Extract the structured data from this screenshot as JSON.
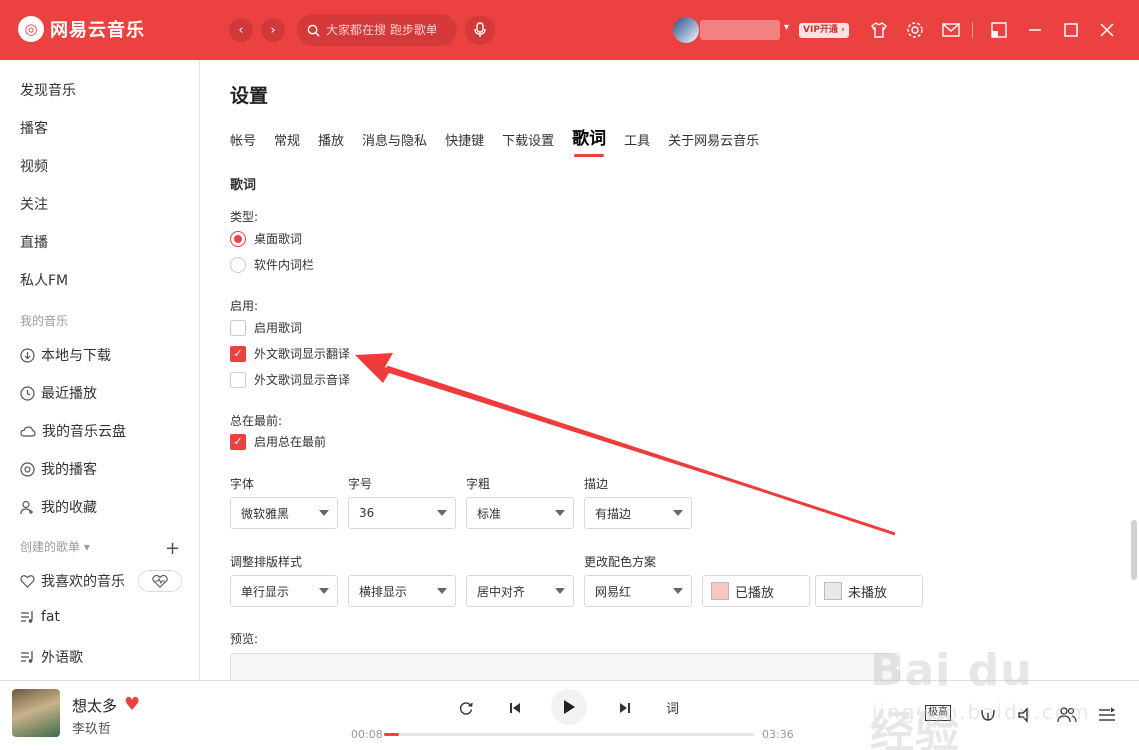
{
  "app": {
    "name": "网易云音乐",
    "logo_glyph": "◎",
    "accent": "#ec4141"
  },
  "header": {
    "back_glyph": "‹",
    "forward_glyph": "›",
    "search_placeholder": "大家都在搜 跑步歌单",
    "vip_badge": "VIP开通 ›",
    "icons": [
      "mic-icon",
      "skin-icon",
      "settings-icon",
      "mail-icon",
      "mini-mode-icon",
      "minimize-icon",
      "maximize-icon",
      "close-icon"
    ]
  },
  "sidebar": {
    "nav": [
      "发现音乐",
      "播客",
      "视频",
      "关注",
      "直播",
      "私人FM"
    ],
    "my_music_title": "我的音乐",
    "my_music": [
      {
        "label": "本地与下载",
        "icon": "download-icon"
      },
      {
        "label": "最近播放",
        "icon": "clock-icon"
      },
      {
        "label": "我的音乐云盘",
        "icon": "cloud-icon"
      },
      {
        "label": "我的播客",
        "icon": "podcast-icon"
      },
      {
        "label": "我的收藏",
        "icon": "user-collect-icon"
      }
    ],
    "created_title": "创建的歌单 ▾",
    "playlists": [
      {
        "label": "我喜欢的音乐",
        "icon": "heart-outline-icon"
      },
      {
        "label": "fat",
        "icon": "playlist-icon"
      },
      {
        "label": "外语歌",
        "icon": "playlist-icon"
      }
    ]
  },
  "settings": {
    "title": "设置",
    "tabs": [
      "帐号",
      "常规",
      "播放",
      "消息与隐私",
      "快捷键",
      "下载设置",
      "歌词",
      "工具",
      "关于网易云音乐"
    ],
    "active_tab": "歌词",
    "section": "歌词",
    "type_label": "类型:",
    "type_options": [
      {
        "label": "桌面歌词",
        "selected": true
      },
      {
        "label": "软件内词栏",
        "selected": false
      }
    ],
    "enable_label": "启用:",
    "enable_options": [
      {
        "label": "启用歌词",
        "checked": false
      },
      {
        "label": "外文歌词显示翻译",
        "checked": true
      },
      {
        "label": "外文歌词显示音译",
        "checked": false
      }
    ],
    "ontop_label": "总在最前:",
    "ontop_option": {
      "label": "启用总在最前",
      "checked": true
    },
    "font_label": "字体",
    "font_value": "微软雅黑",
    "size_label": "字号",
    "size_value": "36",
    "weight_label": "字粗",
    "weight_value": "标准",
    "stroke_label": "描边",
    "stroke_value": "有描边",
    "layout_label": "调整排版样式",
    "layout_values": [
      "单行显示",
      "横排显示",
      "居中对齐"
    ],
    "color_label": "更改配色方案",
    "color_scheme": "网易红",
    "played_label": "已播放",
    "played_color": "#f9c5c5",
    "unplayed_label": "未播放",
    "unplayed_color": "#e8e8e8",
    "preview_label": "预览:"
  },
  "player": {
    "song": "想太多",
    "artist": "李玖哲",
    "current_time": "00:08",
    "total_time": "03:36",
    "progress": 0.04,
    "lyric_button": "词",
    "quality_badge": "极高"
  },
  "watermark": {
    "text": "Bai du 经验",
    "sub": "jingyan.baidu.com"
  }
}
